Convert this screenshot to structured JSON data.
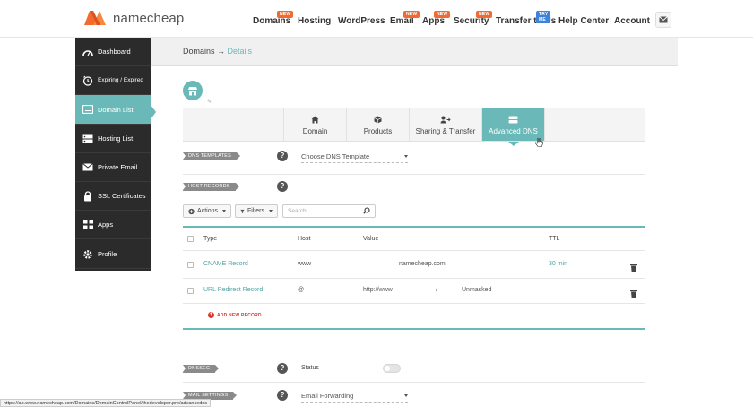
{
  "brand": {
    "name": "namecheap",
    "accent": "#f26a2f",
    "teal": "#6ab8b7"
  },
  "nav": [
    {
      "label": "Domains",
      "badge": "NEW"
    },
    {
      "label": "Hosting",
      "badge": ""
    },
    {
      "label": "WordPress",
      "badge": ""
    },
    {
      "label": "Email",
      "badge": "NEW"
    },
    {
      "label": "Apps",
      "badge": "NEW"
    },
    {
      "label": "Security",
      "badge": "NEW"
    },
    {
      "label": "Transfer to Us",
      "badge": "TRY ME"
    },
    {
      "label": "Help Center",
      "badge": ""
    },
    {
      "label": "Account",
      "badge": ""
    }
  ],
  "sidebar": {
    "items": [
      {
        "label": "Dashboard",
        "icon": "gauge-icon"
      },
      {
        "label": "Expiring / Expired",
        "icon": "clock-icon"
      },
      {
        "label": "Domain List",
        "icon": "list-icon",
        "active": true
      },
      {
        "label": "Hosting List",
        "icon": "server-icon"
      },
      {
        "label": "Private Email",
        "icon": "envelope-icon"
      },
      {
        "label": "SSL Certificates",
        "icon": "lock-icon"
      },
      {
        "label": "Apps",
        "icon": "apps-icon"
      },
      {
        "label": "Profile",
        "icon": "gear-icon"
      }
    ]
  },
  "breadcrumb": {
    "parent": "Domains",
    "separator": "→",
    "current": "Details"
  },
  "tabs": [
    {
      "label": "Domain",
      "icon": "home-icon"
    },
    {
      "label": "Products",
      "icon": "box-icon"
    },
    {
      "label": "Sharing & Transfer",
      "icon": "share-user-icon"
    },
    {
      "label": "Advanced DNS",
      "icon": "dns-icon",
      "active": true
    }
  ],
  "dns_templates": {
    "label": "DNS TEMPLATES",
    "select_value": "Choose DNS Template"
  },
  "host_records": {
    "label": "HOST RECORDS",
    "actions_label": "Actions",
    "filters_label": "Filters",
    "search_placeholder": "Search",
    "columns": {
      "type": "Type",
      "host": "Host",
      "value": "Value",
      "ttl": "TTL"
    },
    "rows": [
      {
        "type": "CNAME Record",
        "host": "www",
        "value": "namecheap.com",
        "ttl": "30 min"
      },
      {
        "type": "URL Redirect Record",
        "host": "@",
        "value": "http://www",
        "value_suffix": "/",
        "extra": "Unmasked",
        "ttl": ""
      }
    ],
    "add_label": "ADD NEW RECORD"
  },
  "dnssec": {
    "label": "DNSSEC",
    "status_label": "Status",
    "enabled": false
  },
  "mail_settings": {
    "label": "MAIL SETTINGS",
    "select_value": "Email Forwarding"
  },
  "statusbar": {
    "url": "https://ap.www.namecheap.com/Domains/DomainControlPanel/thedeveloper.pro/advancedns"
  }
}
